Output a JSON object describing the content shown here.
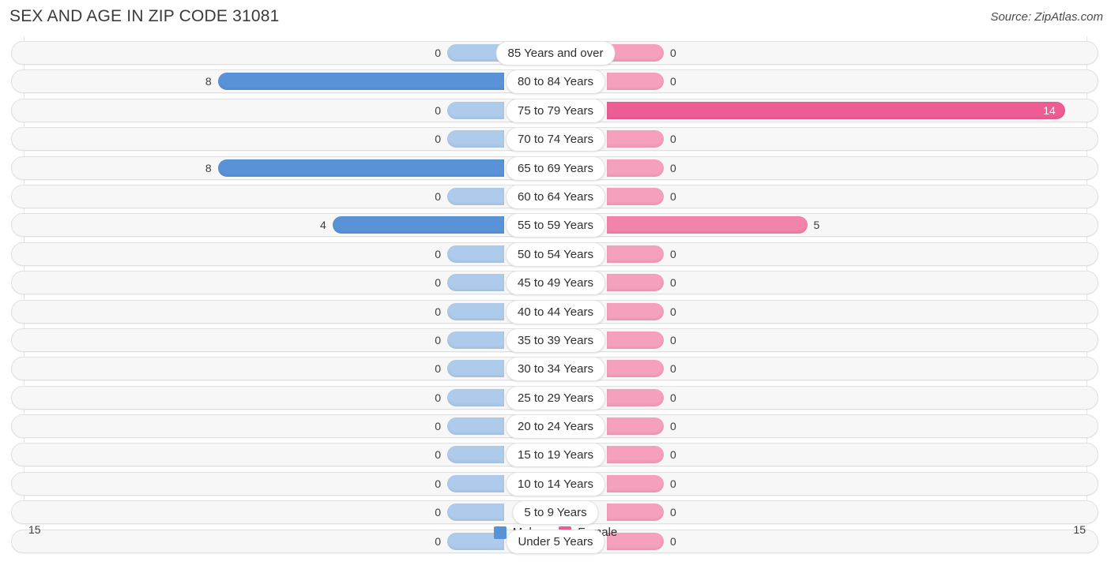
{
  "header": {
    "title": "SEX AND AGE IN ZIP CODE 31081",
    "source": "Source: ZipAtlas.com"
  },
  "axis": {
    "left_end": "15",
    "right_end": "15"
  },
  "legend": {
    "items": [
      {
        "label": "Male",
        "color": "#5a92d8",
        "swatch_icon": "square-swatch"
      },
      {
        "label": "Female",
        "color": "#ed5c92",
        "swatch_icon": "square-swatch"
      }
    ]
  },
  "colors": {
    "male": "#5a92d8",
    "male_zero": "#aecbeb",
    "female": "#ed5c92",
    "female_mid": "#f283ab",
    "female_zero": "#f5a0bd",
    "track": "#f7f7f7",
    "track_border": "#e0e0e0"
  },
  "chart_data": {
    "type": "bar",
    "subtype": "population-pyramid",
    "title": "SEX AND AGE IN ZIP CODE 31081",
    "xlabel": "",
    "ylabel": "",
    "xlim": [
      15,
      15
    ],
    "grid": true,
    "legend_position": "bottom-center",
    "categories": [
      "85 Years and over",
      "80 to 84 Years",
      "75 to 79 Years",
      "70 to 74 Years",
      "65 to 69 Years",
      "60 to 64 Years",
      "55 to 59 Years",
      "50 to 54 Years",
      "45 to 49 Years",
      "40 to 44 Years",
      "35 to 39 Years",
      "30 to 34 Years",
      "25 to 29 Years",
      "20 to 24 Years",
      "15 to 19 Years",
      "10 to 14 Years",
      "5 to 9 Years",
      "Under 5 Years"
    ],
    "series": [
      {
        "name": "Male",
        "values": [
          0,
          8,
          0,
          0,
          8,
          0,
          4,
          0,
          0,
          0,
          0,
          0,
          0,
          0,
          0,
          0,
          0,
          0
        ]
      },
      {
        "name": "Female",
        "values": [
          0,
          0,
          14,
          0,
          0,
          0,
          5,
          0,
          0,
          0,
          0,
          0,
          0,
          0,
          0,
          0,
          0,
          0
        ]
      }
    ]
  },
  "rows": [
    {
      "label": "85 Years and over",
      "male": "0",
      "female": "0"
    },
    {
      "label": "80 to 84 Years",
      "male": "8",
      "female": "0"
    },
    {
      "label": "75 to 79 Years",
      "male": "0",
      "female": "14"
    },
    {
      "label": "70 to 74 Years",
      "male": "0",
      "female": "0"
    },
    {
      "label": "65 to 69 Years",
      "male": "8",
      "female": "0"
    },
    {
      "label": "60 to 64 Years",
      "male": "0",
      "female": "0"
    },
    {
      "label": "55 to 59 Years",
      "male": "4",
      "female": "5"
    },
    {
      "label": "50 to 54 Years",
      "male": "0",
      "female": "0"
    },
    {
      "label": "45 to 49 Years",
      "male": "0",
      "female": "0"
    },
    {
      "label": "40 to 44 Years",
      "male": "0",
      "female": "0"
    },
    {
      "label": "35 to 39 Years",
      "male": "0",
      "female": "0"
    },
    {
      "label": "30 to 34 Years",
      "male": "0",
      "female": "0"
    },
    {
      "label": "25 to 29 Years",
      "male": "0",
      "female": "0"
    },
    {
      "label": "20 to 24 Years",
      "male": "0",
      "female": "0"
    },
    {
      "label": "15 to 19 Years",
      "male": "0",
      "female": "0"
    },
    {
      "label": "10 to 14 Years",
      "male": "0",
      "female": "0"
    },
    {
      "label": "5 to 9 Years",
      "male": "0",
      "female": "0"
    },
    {
      "label": "Under 5 Years",
      "male": "0",
      "female": "0"
    }
  ]
}
